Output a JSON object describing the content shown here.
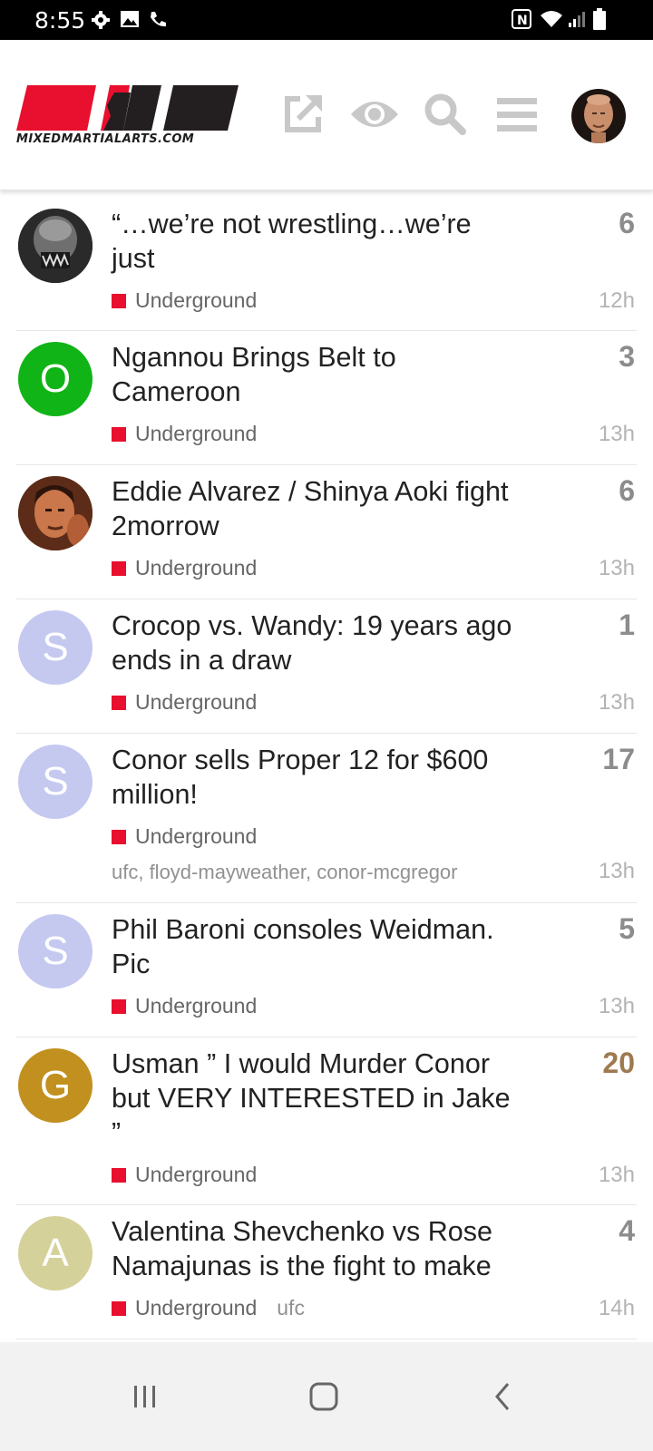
{
  "status_bar": {
    "time": "8:55",
    "icons": [
      "settings-icon",
      "image-icon",
      "wifi-call-icon",
      "nfc-icon",
      "wifi-icon",
      "signal-icon",
      "battery-icon"
    ]
  },
  "header": {
    "logo_text": "MIXEDMARTIALARTS.COM",
    "logo_colors": {
      "red": "#e8102e",
      "dark": "#231f20"
    },
    "actions": [
      "share-icon",
      "eye-icon",
      "search-icon",
      "menu-icon",
      "user-avatar"
    ]
  },
  "topics": [
    {
      "title": "“…we’re not wrestling…we’re just",
      "replies": "6",
      "category": "Underground",
      "tags": "",
      "age": "12h",
      "avatar_letter": "",
      "avatar_color": "#222222"
    },
    {
      "title": "Ngannou Brings Belt to Cameroon",
      "replies": "3",
      "category": "Underground",
      "tags": "",
      "age": "13h",
      "avatar_letter": "O",
      "avatar_color": "#11b416"
    },
    {
      "title": "Eddie Alvarez / Shinya Aoki fight 2morrow",
      "replies": "6",
      "category": "Underground",
      "tags": "",
      "age": "13h",
      "avatar_letter": "",
      "avatar_color": "#a0522d"
    },
    {
      "title": "Crocop vs. Wandy: 19 years ago ends in a draw",
      "replies": "1",
      "category": "Underground",
      "tags": "",
      "age": "13h",
      "avatar_letter": "S",
      "avatar_color": "#c5c9f0"
    },
    {
      "title": "Conor sells Proper 12 for $600 million!",
      "replies": "17",
      "category": "Underground",
      "tags": "ufc, floyd-mayweather, conor-mcgregor",
      "age": "13h",
      "avatar_letter": "S",
      "avatar_color": "#c5c9f0"
    },
    {
      "title": "Phil Baroni consoles Weidman. Pic",
      "replies": "5",
      "category": "Underground",
      "tags": "",
      "age": "13h",
      "avatar_letter": "S",
      "avatar_color": "#c5c9f0"
    },
    {
      "title": "Usman ” I would Murder Conor but VERY INTERESTED in Jake ”",
      "replies": "20",
      "category": "Underground",
      "tags": "",
      "age": "13h",
      "avatar_letter": "G",
      "avatar_color": "#c1901e"
    },
    {
      "title": "Valentina Shevchenko vs Rose Namajunas is the fight to make",
      "replies": "4",
      "category": "Underground",
      "tags": "ufc",
      "age": "14h",
      "avatar_letter": "A",
      "avatar_color": "#d4d29a"
    }
  ],
  "category_color": "#e8102e",
  "nav_bar": [
    "recents-icon",
    "home-icon",
    "back-icon"
  ]
}
